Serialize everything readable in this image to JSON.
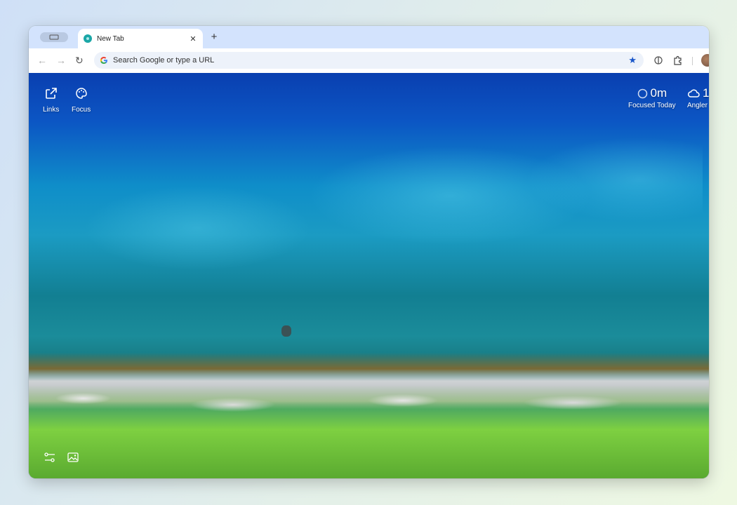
{
  "browser": {
    "tab": {
      "title": "New Tab",
      "close_icon": "close-icon"
    },
    "omnibox": {
      "placeholder": "Search Google or type a URL"
    }
  },
  "newtab": {
    "top_left": [
      {
        "label": "Links",
        "icon": "external-link-icon"
      },
      {
        "label": "Focus",
        "icon": "palette-icon"
      }
    ],
    "focused": {
      "value": "0m",
      "label": "Focused Today"
    },
    "weather": {
      "value": "1",
      "label": "Angler"
    },
    "bottom_left": [
      "settings-sliders-icon",
      "image-icon"
    ]
  },
  "colors": {
    "tabstrip": "#d3e3fd",
    "accent_star": "#1a57c9",
    "favicon": "#1ba7a7"
  }
}
